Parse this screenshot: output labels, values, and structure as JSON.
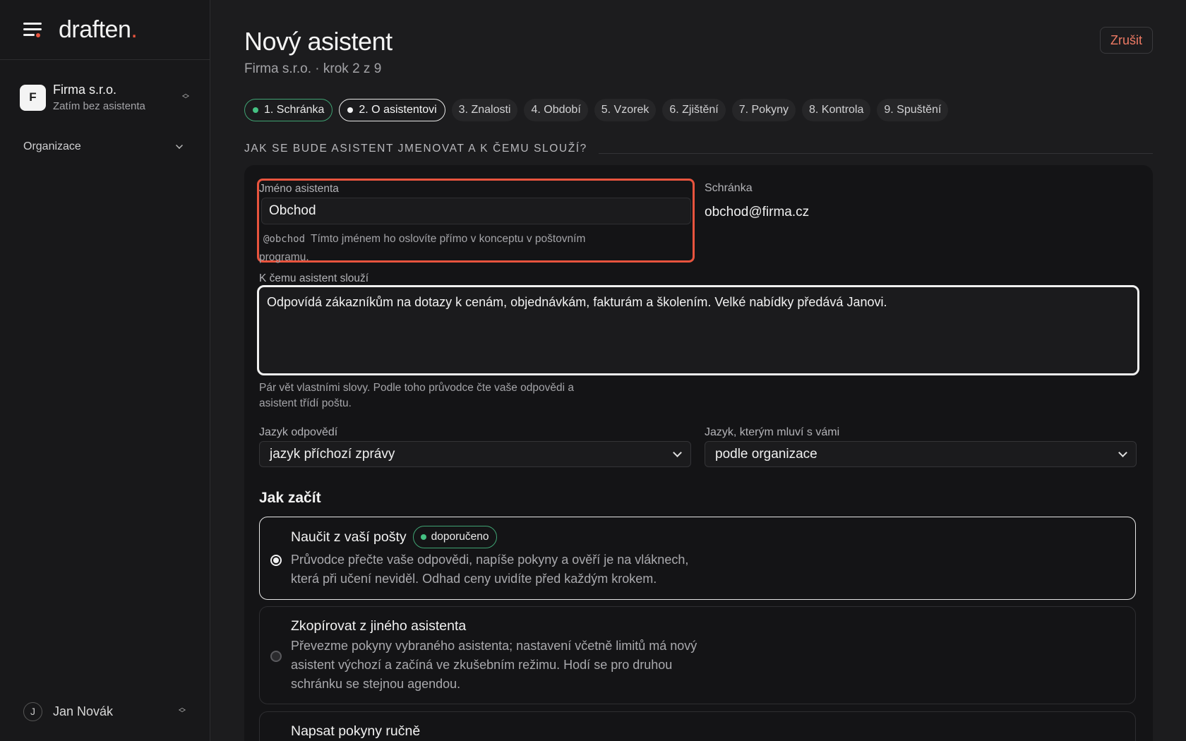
{
  "sidebar": {
    "logo_text": "draften",
    "logo_dot": ".",
    "org": {
      "initial": "F",
      "name": "Firma s.r.o.",
      "subtitle": "Zatím bez asistenta"
    },
    "nav": [
      {
        "label": "Organizace"
      }
    ],
    "user": {
      "initial": "J",
      "name": "Jan Novák"
    }
  },
  "header": {
    "title": "Nový asistent",
    "subtitle": "Firma s.r.o. · krok 2 z 9",
    "cancel_label": "Zrušit"
  },
  "steps": [
    {
      "label": "1. Schránka",
      "state": "done"
    },
    {
      "label": "2. O asistentovi",
      "state": "active"
    },
    {
      "label": "3. Znalosti",
      "state": "pending"
    },
    {
      "label": "4. Období",
      "state": "pending"
    },
    {
      "label": "5. Vzorek",
      "state": "pending"
    },
    {
      "label": "6. Zjištění",
      "state": "pending"
    },
    {
      "label": "7. Pokyny",
      "state": "pending"
    },
    {
      "label": "8. Kontrola",
      "state": "pending"
    },
    {
      "label": "9. Spuštění",
      "state": "pending"
    }
  ],
  "section": {
    "heading": "JAK SE BUDE ASISTENT JMENOVAT A K ČEMU SLOUŽÍ?"
  },
  "form": {
    "name": {
      "label": "Jméno asistenta",
      "value": "Obchod",
      "handle": "@obchod",
      "help": "Tímto jménem ho oslovíte přímo v konceptu v poštovním programu."
    },
    "mailbox": {
      "label": "Schránka",
      "value": "obchod@firma.cz"
    },
    "purpose": {
      "label": "K čemu asistent slouží",
      "value": "Odpovídá zákazníkům na dotazy k cenám, objednávkám, fakturám a školením. Velké nabídky předává Janovi.",
      "help": "Pár vět vlastními slovy. Podle toho průvodce čte vaše odpovědi a asistent třídí poštu."
    },
    "reply_language": {
      "label": "Jazyk odpovědí",
      "value": "jazyk příchozí zprávy"
    },
    "ui_language": {
      "label": "Jazyk, kterým mluví s vámi",
      "value": "podle organizace"
    }
  },
  "start": {
    "title": "Jak začít",
    "options": [
      {
        "title": "Naučit z vaší pošty",
        "badge": "doporučeno",
        "desc": "Průvodce přečte vaše odpovědi, napíše pokyny a ověří je na vláknech, která při učení neviděl. Odhad ceny uvidíte před každým krokem.",
        "selected": true
      },
      {
        "title": "Zkopírovat z jiného asistenta",
        "desc": "Převezme pokyny vybraného asistenta; nastavení včetně limitů má nový asistent výchozí a začíná ve zkušebním režimu. Hodí se pro druhou schránku se stejnou agendou.",
        "selected": false
      },
      {
        "title": "Napsat pokyny ručně",
        "desc": "",
        "selected": false
      }
    ]
  },
  "colors": {
    "accent": "#e8543e",
    "success": "#45c183",
    "background": "#1c1c1e"
  }
}
